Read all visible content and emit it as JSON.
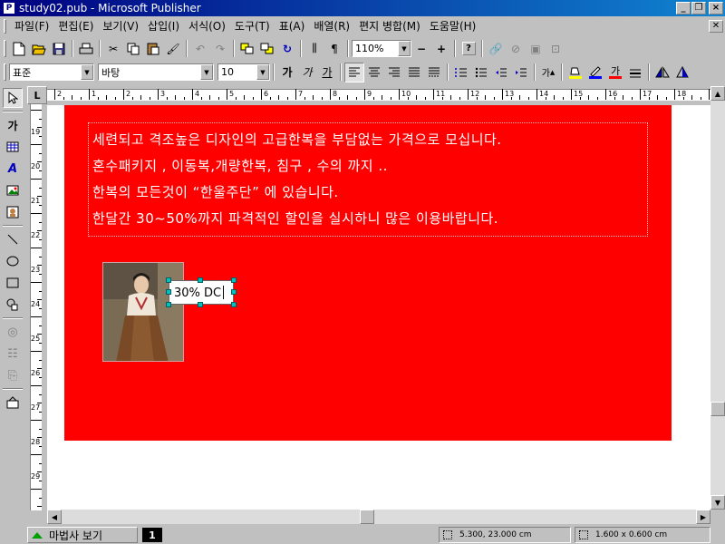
{
  "window": {
    "title": "study02.pub - Microsoft Publisher",
    "app_icon": "publisher-icon",
    "controls": [
      "_",
      "❐",
      "×"
    ]
  },
  "menu": {
    "items": [
      "파일(F)",
      "편집(E)",
      "보기(V)",
      "삽입(I)",
      "서식(O)",
      "도구(T)",
      "표(A)",
      "배열(R)",
      "편지 병합(M)",
      "도움말(H)"
    ]
  },
  "toolbar_standard": {
    "zoom_value": "110%",
    "zoom_out": "−",
    "zoom_in": "+"
  },
  "toolbar_format": {
    "style_value": "표준",
    "font_value": "바탕",
    "size_value": "10",
    "bold_label": "가",
    "italic_label": "가",
    "underline_label": "가",
    "font_grow_label": "가",
    "font_color_label": "가"
  },
  "ruler": {
    "corner_label": "L",
    "h_numbers": [
      "2",
      "1",
      "2",
      "3",
      "4",
      "5",
      "6",
      "7",
      "8",
      "9",
      "10",
      "11",
      "12",
      "13",
      "14",
      "15",
      "16",
      "17",
      "18",
      "19"
    ],
    "v_numbers": [
      "19",
      "20",
      "21",
      "22",
      "23",
      "24",
      "25",
      "26",
      "27",
      "28",
      "29"
    ]
  },
  "objects_toolbar": {
    "text_tool_label": "가"
  },
  "document": {
    "text_lines": [
      "세련되고 격조높은 디자인의 고급한복을 부담없는 가격으로 모십니다.",
      "혼수패키지 , 이동복,개량한복, 침구 , 수의 까지 ..",
      "한복의 모든것이 “한울주단” 에 있습니다.",
      "한달간 30~50%까지 파격적인 할인을 실시하니 많은 이용바랍니다."
    ],
    "dc_text": "30% DC",
    "page_color": "#ff0000"
  },
  "status": {
    "wizard_label": "마법사 보기",
    "page_number": "1",
    "position": "5.300, 23.000 cm",
    "size": "1.600 x  0.600 cm"
  }
}
